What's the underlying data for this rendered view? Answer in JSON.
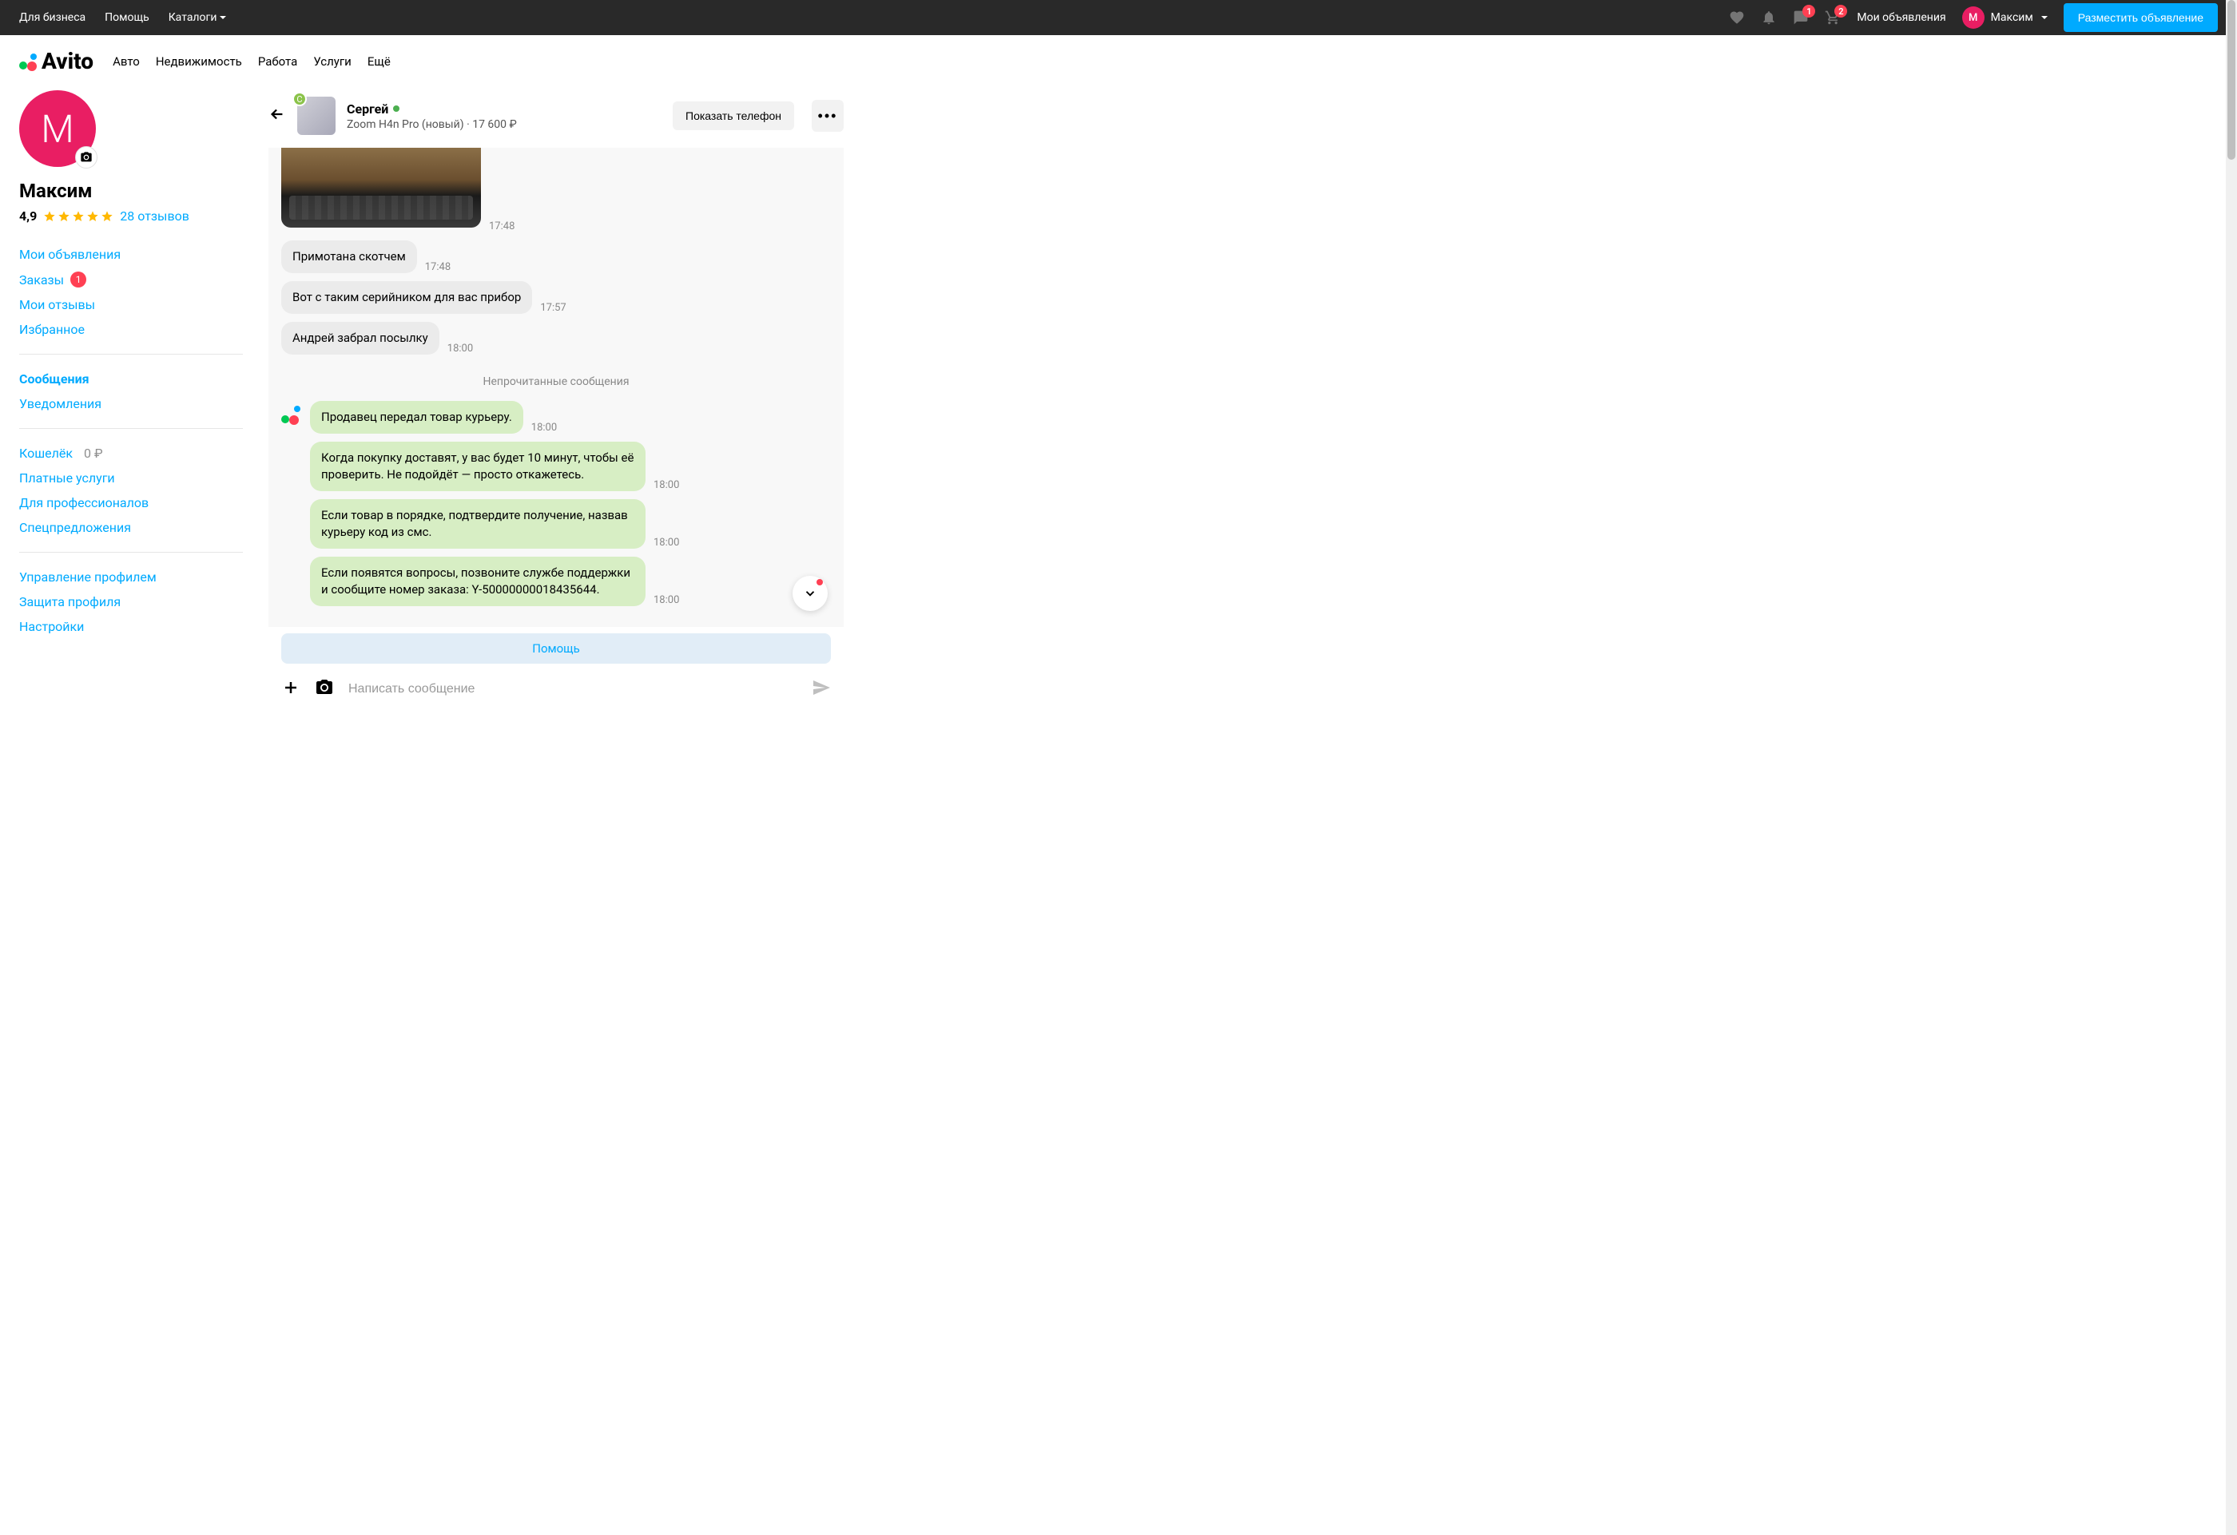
{
  "topbar": {
    "business": "Для бизнеса",
    "help": "Помощь",
    "catalogs": "Каталоги",
    "messages_badge": "1",
    "cart_badge": "2",
    "my_ads": "Мои объявления",
    "user_initial": "М",
    "user_name": "Максим",
    "post_btn": "Разместить объявление"
  },
  "nav": {
    "logo": "Avito",
    "items": [
      "Авто",
      "Недвижимость",
      "Работа",
      "Услуги",
      "Ещё"
    ]
  },
  "profile": {
    "initial": "М",
    "name": "Максим",
    "rating": "4,9",
    "reviews": "28 отзывов"
  },
  "sidenav": {
    "my_ads": "Мои объявления",
    "orders": "Заказы",
    "orders_badge": "1",
    "my_reviews": "Мои отзывы",
    "favorites": "Избранное",
    "messages": "Сообщения",
    "notifications": "Уведомления",
    "wallet": "Кошелёк",
    "wallet_balance": "0 ₽",
    "paid": "Платные услуги",
    "pro": "Для профессионалов",
    "special": "Спецпредложения",
    "manage": "Управление профилем",
    "protect": "Защита профиля",
    "settings": "Настройки"
  },
  "chat": {
    "seller_initial": "С",
    "seller_name": "Сергей",
    "item_line": "Zoom H4n Pro (новый) · 17 600 ₽",
    "show_phone": "Показать телефон",
    "img_time": "17:48",
    "msgs": [
      {
        "text": "Примотана скотчем",
        "time": "17:48"
      },
      {
        "text": "Вот с таким серийником для вас прибор",
        "time": "17:57"
      },
      {
        "text": "Андрей забрал посылку",
        "time": "18:00"
      }
    ],
    "unread": "Непрочитанные сообщения",
    "system": [
      {
        "text": "Продавец передал товар курьеру.",
        "time": "18:00"
      },
      {
        "text": "Когда покупку доставят, у вас будет 10 минут, чтобы её проверить. Не подойдёт — просто откажетесь.",
        "time": "18:00"
      },
      {
        "text": "Если товар в порядке, подтвердите получение, назвав курьеру код из смс.",
        "time": "18:00"
      },
      {
        "text": "Если появятся вопросы, позвоните службе поддержки и сообщите номер заказа: Y-50000000018435644.",
        "time": "18:00"
      }
    ],
    "help": "Помощь",
    "placeholder": "Написать сообщение"
  }
}
